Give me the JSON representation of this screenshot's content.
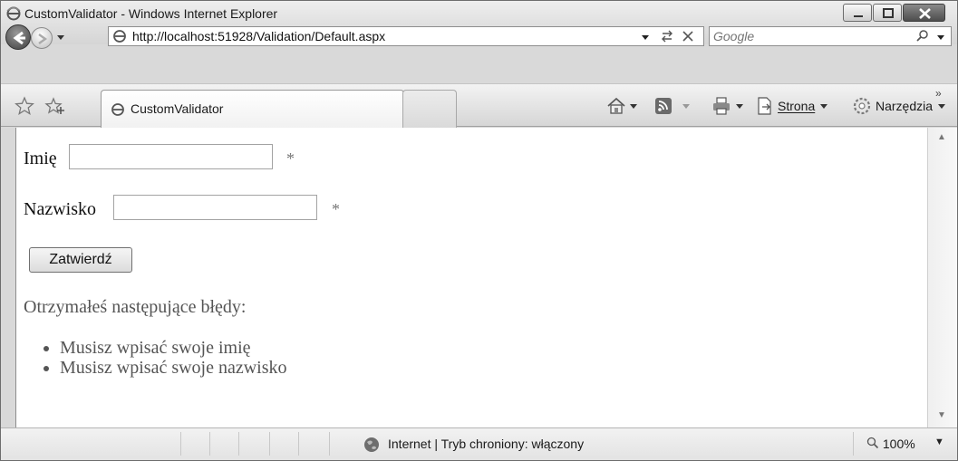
{
  "window": {
    "title": "CustomValidator - Windows Internet Explorer"
  },
  "address": {
    "url": "http://localhost:51928/Validation/Default.aspx"
  },
  "search": {
    "placeholder": "Google"
  },
  "tab": {
    "title": "CustomValidator"
  },
  "commands": {
    "page_label": "Strona",
    "tools_label": "Narzędzia",
    "more": "»"
  },
  "form": {
    "first_name_label": "Imię",
    "first_name_value": "",
    "first_name_marker": "*",
    "last_name_label": "Nazwisko",
    "last_name_value": "",
    "last_name_marker": "*",
    "submit_label": "Zatwierdź"
  },
  "validation": {
    "heading": "Otrzymałeś następujące błędy:",
    "errors": [
      "Musisz wpisać swoje imię",
      "Musisz wpisać swoje nazwisko"
    ]
  },
  "status": {
    "zone_text": "Internet | Tryb chroniony: włączony",
    "zoom": "100%"
  },
  "icons": {
    "browser": "ie-page-icon",
    "back": "back-arrow-icon",
    "forward": "forward-arrow-icon",
    "refresh": "refresh-icon",
    "stop": "stop-icon",
    "search": "search-icon",
    "favorites": "favorites-star-icon",
    "add_favorites": "add-favorites-icon",
    "home": "home-icon",
    "feeds": "rss-feed-icon",
    "print": "print-icon",
    "page": "page-icon",
    "tools": "gear-icon",
    "globe": "globe-icon",
    "zoom": "magnifier-icon"
  }
}
